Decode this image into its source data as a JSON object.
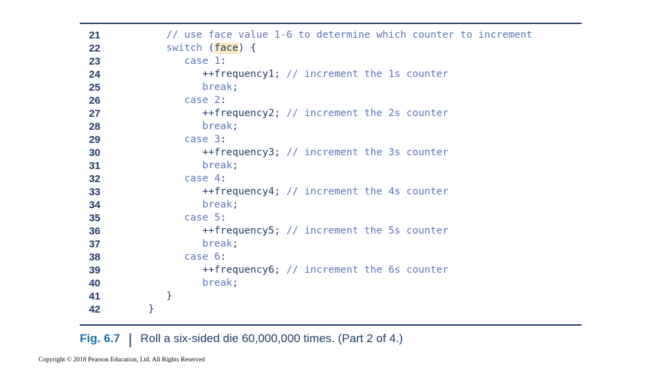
{
  "code_lines": [
    {
      "num": "21",
      "parts": [
        [
          "",
          "        "
        ],
        [
          "c",
          "// use face value 1-6 to determine which counter to increment"
        ]
      ]
    },
    {
      "num": "22",
      "parts": [
        [
          "",
          "        "
        ],
        [
          "k",
          "switch"
        ],
        [
          "",
          " ("
        ],
        [
          "hl",
          "face"
        ],
        [
          "",
          ") {"
        ]
      ]
    },
    {
      "num": "23",
      "parts": [
        [
          "",
          "           "
        ],
        [
          "k",
          "case"
        ],
        [
          "",
          " "
        ],
        [
          "n",
          "1"
        ],
        [
          "",
          ":"
        ]
      ]
    },
    {
      "num": "24",
      "parts": [
        [
          "",
          "              ++frequency1; "
        ],
        [
          "c",
          "// increment the 1s counter"
        ]
      ]
    },
    {
      "num": "25",
      "parts": [
        [
          "",
          "              "
        ],
        [
          "k",
          "break"
        ],
        [
          "",
          ";"
        ]
      ]
    },
    {
      "num": "26",
      "parts": [
        [
          "",
          "           "
        ],
        [
          "k",
          "case"
        ],
        [
          "",
          " "
        ],
        [
          "n",
          "2"
        ],
        [
          "",
          ":"
        ]
      ]
    },
    {
      "num": "27",
      "parts": [
        [
          "",
          "              ++frequency2; "
        ],
        [
          "c",
          "// increment the 2s counter"
        ]
      ]
    },
    {
      "num": "28",
      "parts": [
        [
          "",
          "              "
        ],
        [
          "k",
          "break"
        ],
        [
          "",
          ";"
        ]
      ]
    },
    {
      "num": "29",
      "parts": [
        [
          "",
          "           "
        ],
        [
          "k",
          "case"
        ],
        [
          "",
          " "
        ],
        [
          "n",
          "3"
        ],
        [
          "",
          ":"
        ]
      ]
    },
    {
      "num": "30",
      "parts": [
        [
          "",
          "              ++frequency3; "
        ],
        [
          "c",
          "// increment the 3s counter"
        ]
      ]
    },
    {
      "num": "31",
      "parts": [
        [
          "",
          "              "
        ],
        [
          "k",
          "break"
        ],
        [
          "",
          ";"
        ]
      ]
    },
    {
      "num": "32",
      "parts": [
        [
          "",
          "           "
        ],
        [
          "k",
          "case"
        ],
        [
          "",
          " "
        ],
        [
          "n",
          "4"
        ],
        [
          "",
          ":"
        ]
      ]
    },
    {
      "num": "33",
      "parts": [
        [
          "",
          "              ++frequency4; "
        ],
        [
          "c",
          "// increment the 4s counter"
        ]
      ]
    },
    {
      "num": "34",
      "parts": [
        [
          "",
          "              "
        ],
        [
          "k",
          "break"
        ],
        [
          "",
          ";"
        ]
      ]
    },
    {
      "num": "35",
      "parts": [
        [
          "",
          "           "
        ],
        [
          "k",
          "case"
        ],
        [
          "",
          " "
        ],
        [
          "n",
          "5"
        ],
        [
          "",
          ":"
        ]
      ]
    },
    {
      "num": "36",
      "parts": [
        [
          "",
          "              ++frequency5; "
        ],
        [
          "c",
          "// increment the 5s counter"
        ]
      ]
    },
    {
      "num": "37",
      "parts": [
        [
          "",
          "              "
        ],
        [
          "k",
          "break"
        ],
        [
          "",
          ";"
        ]
      ]
    },
    {
      "num": "38",
      "parts": [
        [
          "",
          "           "
        ],
        [
          "k",
          "case"
        ],
        [
          "",
          " "
        ],
        [
          "n",
          "6"
        ],
        [
          "",
          ":"
        ]
      ]
    },
    {
      "num": "39",
      "parts": [
        [
          "",
          "              ++frequency6; "
        ],
        [
          "c",
          "// increment the 6s counter"
        ]
      ]
    },
    {
      "num": "40",
      "parts": [
        [
          "",
          "              "
        ],
        [
          "k",
          "break"
        ],
        [
          "",
          ";"
        ]
      ]
    },
    {
      "num": "41",
      "parts": [
        [
          "",
          "        }"
        ]
      ]
    },
    {
      "num": "42",
      "parts": [
        [
          "",
          "     }"
        ]
      ]
    }
  ],
  "caption": {
    "label": "Fig. 6.7",
    "separator": "|",
    "text": "Roll a six-sided die 60,000,000 times. (Part 2 of 4.)"
  },
  "copyright": "Copyright © 2018 Pearson Education, Ltd. All Rights Reserved"
}
